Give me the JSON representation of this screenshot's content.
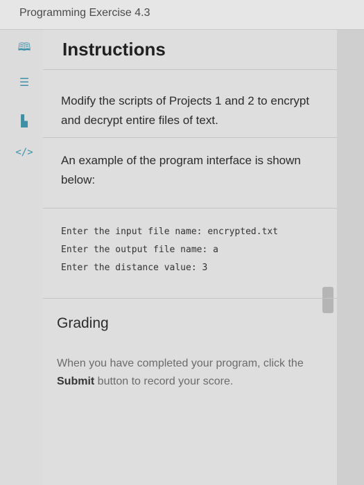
{
  "header": {
    "title": "Programming Exercise 4.3"
  },
  "rail": {
    "icons": [
      {
        "name": "book-icon",
        "glyph": "🕮"
      },
      {
        "name": "list-icon",
        "glyph": "☰"
      },
      {
        "name": "chart-icon",
        "glyph": "▙"
      },
      {
        "name": "code-icon",
        "glyph": "</>"
      }
    ]
  },
  "instructions": {
    "heading": "Instructions",
    "paragraph1": "Modify the scripts of Projects 1 and 2 to encrypt and decrypt entire files of text.",
    "paragraph2": "An example of the program interface is shown below:",
    "code_lines": [
      "Enter the input file name: encrypted.txt",
      "Enter the output file name: a",
      "Enter the distance value: 3"
    ]
  },
  "grading": {
    "title": "Grading",
    "text_before": "When you have completed your program, click the ",
    "text_bold": "Submit",
    "text_after": " button to record your score."
  }
}
